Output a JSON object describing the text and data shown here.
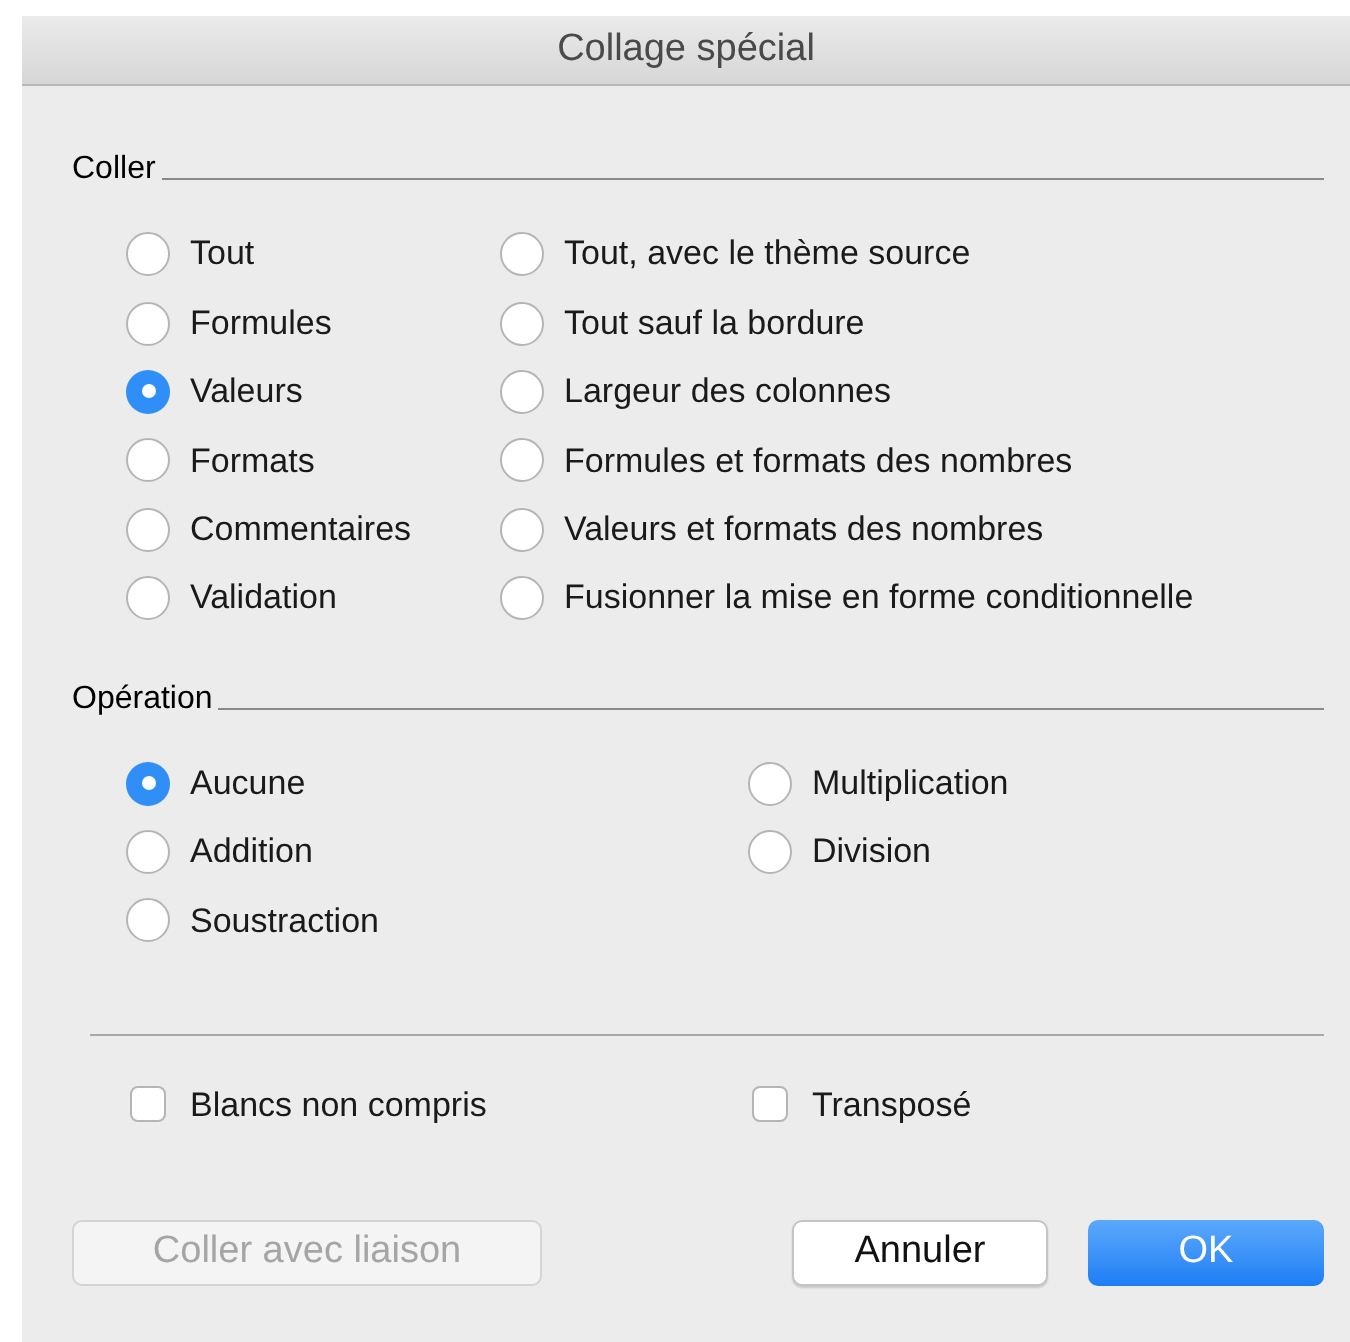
{
  "window": {
    "title": "Collage spécial"
  },
  "paste": {
    "label": "Coller",
    "options": [
      {
        "label": "Tout",
        "selected": false
      },
      {
        "label": "Tout, avec le thème source",
        "selected": false
      },
      {
        "label": "Formules",
        "selected": false
      },
      {
        "label": "Tout sauf la bordure",
        "selected": false
      },
      {
        "label": "Valeurs",
        "selected": true
      },
      {
        "label": "Largeur des colonnes",
        "selected": false
      },
      {
        "label": "Formats",
        "selected": false
      },
      {
        "label": "Formules et formats des nombres",
        "selected": false
      },
      {
        "label": "Commentaires",
        "selected": false
      },
      {
        "label": "Valeurs et formats des nombres",
        "selected": false
      },
      {
        "label": "Validation",
        "selected": false
      },
      {
        "label": "Fusionner la mise en forme conditionnelle",
        "selected": false
      }
    ]
  },
  "operation": {
    "label": "Opération",
    "options": [
      {
        "label": "Aucune",
        "selected": true
      },
      {
        "label": "Multiplication",
        "selected": false
      },
      {
        "label": "Addition",
        "selected": false
      },
      {
        "label": "Division",
        "selected": false
      },
      {
        "label": "Soustraction",
        "selected": false
      }
    ]
  },
  "checkboxes": [
    {
      "label": "Blancs non compris",
      "checked": false
    },
    {
      "label": "Transposé",
      "checked": false
    }
  ],
  "buttons": [
    {
      "label": "Coller avec liaison",
      "kind": "secondary",
      "disabled": true
    },
    {
      "label": "Annuler",
      "kind": "secondary",
      "disabled": false
    },
    {
      "label": "OK",
      "kind": "primary",
      "disabled": false
    }
  ]
}
